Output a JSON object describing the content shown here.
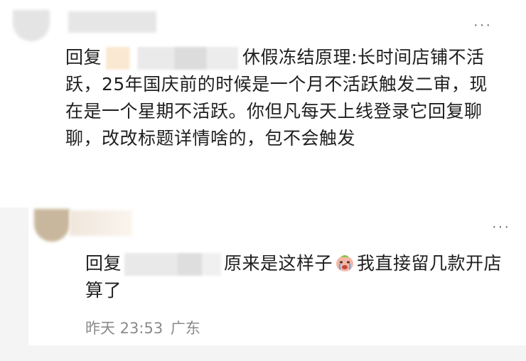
{
  "comment1": {
    "more_label": "···",
    "reply_prefix": "回复",
    "reply_body": "休假冻结原理:长时间店铺不活跃，25年国庆前的时候是一个月不活跃触发二审，现在是一个星期不活跃。你但凡每天上线登录它回复聊聊，改改标题详情啥的，包不会触发"
  },
  "comment2": {
    "more_label": "···",
    "reply_prefix": "回复",
    "reply_body_before_emoji": "原来是这样子",
    "emoji_name": "crying-face-emoji",
    "reply_body_after_emoji": "我直接留几款开店算了",
    "timestamp": "昨天 23:53",
    "location": "广东"
  },
  "colors": {
    "text": "#1f1f1f",
    "meta": "#8a8a8a",
    "shade": "#f4f4f4"
  }
}
